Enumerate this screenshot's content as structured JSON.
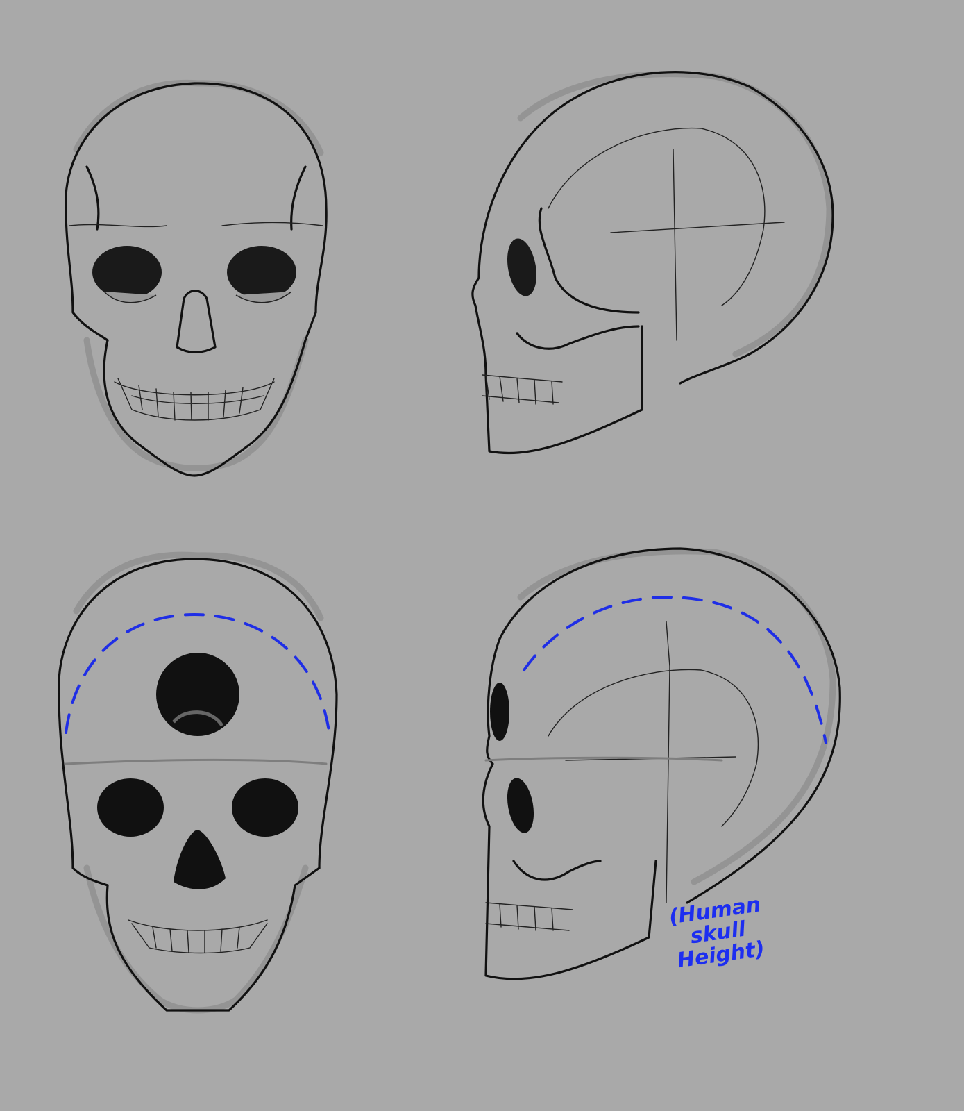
{
  "annotation": {
    "lines": [
      "(Human",
      "skull",
      "Height)"
    ],
    "color": "#1d2ef0"
  },
  "colors": {
    "background": "#a9a9a9",
    "ink": "#111111",
    "guide": "#1f2ee6"
  }
}
